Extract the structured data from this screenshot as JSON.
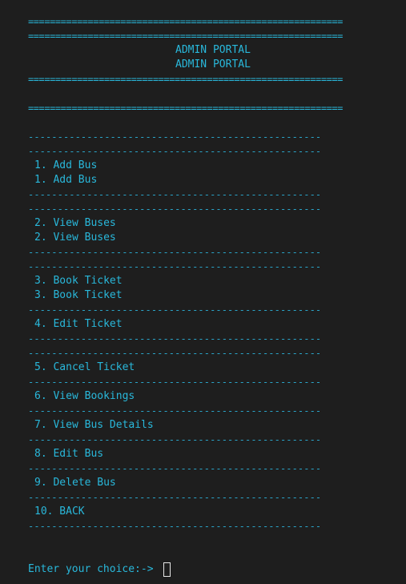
{
  "terminal": {
    "eq_line": "==========================================================",
    "dash_line": "--------------------------------------------------",
    "title": "ADMIN PORTAL",
    "menu": [
      "1. Add Bus",
      "2. View Buses",
      "3. Book Ticket",
      "4. Edit Ticket",
      "5. Cancel Ticket",
      "6. View Bookings",
      "7. View Bus Details",
      "8. Edit Bus",
      "9. Delete Bus",
      "10. BACK"
    ],
    "prompt": "Enter your choice:-> "
  },
  "colors": {
    "background": "#1e1e1e",
    "text": "#29b8db",
    "cursor": "#e6e6e6"
  }
}
